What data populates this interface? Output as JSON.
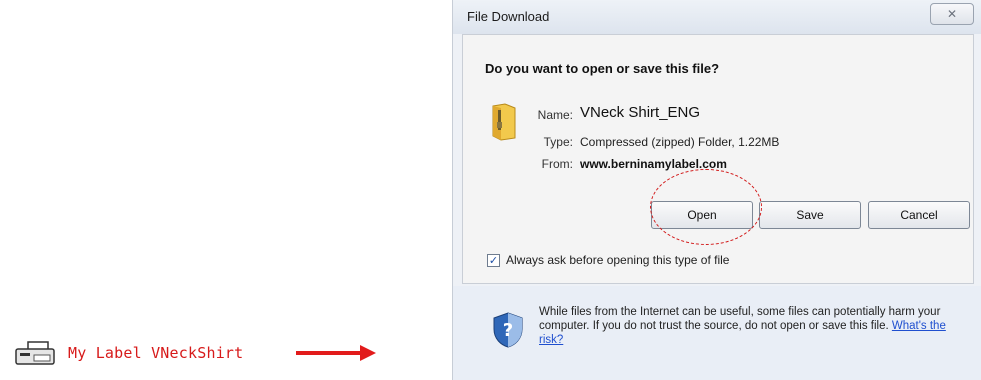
{
  "page": {
    "link_text": "My Label VNeckShirt"
  },
  "dialog": {
    "title": "File Download",
    "close_glyph": "✕",
    "question": "Do you want to open or save this file?",
    "labels": {
      "name": "Name:",
      "type": "Type:",
      "from": "From:"
    },
    "file": {
      "name": "VNeck Shirt_ENG",
      "type": "Compressed (zipped) Folder, 1.22MB",
      "from": "www.berninamylabel.com"
    },
    "buttons": {
      "open": "Open",
      "save": "Save",
      "cancel": "Cancel"
    },
    "checkbox": {
      "label": "Always ask before opening this type of file",
      "checked": true
    },
    "warning": {
      "text": "While files from the Internet can be useful, some files can potentially harm your computer. If you do not trust the source, do not open or save this file.",
      "link": "What's the risk?"
    }
  },
  "icons": {
    "file": "printer-icon",
    "folder": "zip-folder-icon",
    "shield": "security-shield-icon",
    "arrow": "red-arrow-icon"
  },
  "colors": {
    "link": "#d71a1a",
    "annotation": "#d21a1a",
    "dialog_bg": "#eef1f6",
    "hyperlink": "#1f4fcf"
  }
}
